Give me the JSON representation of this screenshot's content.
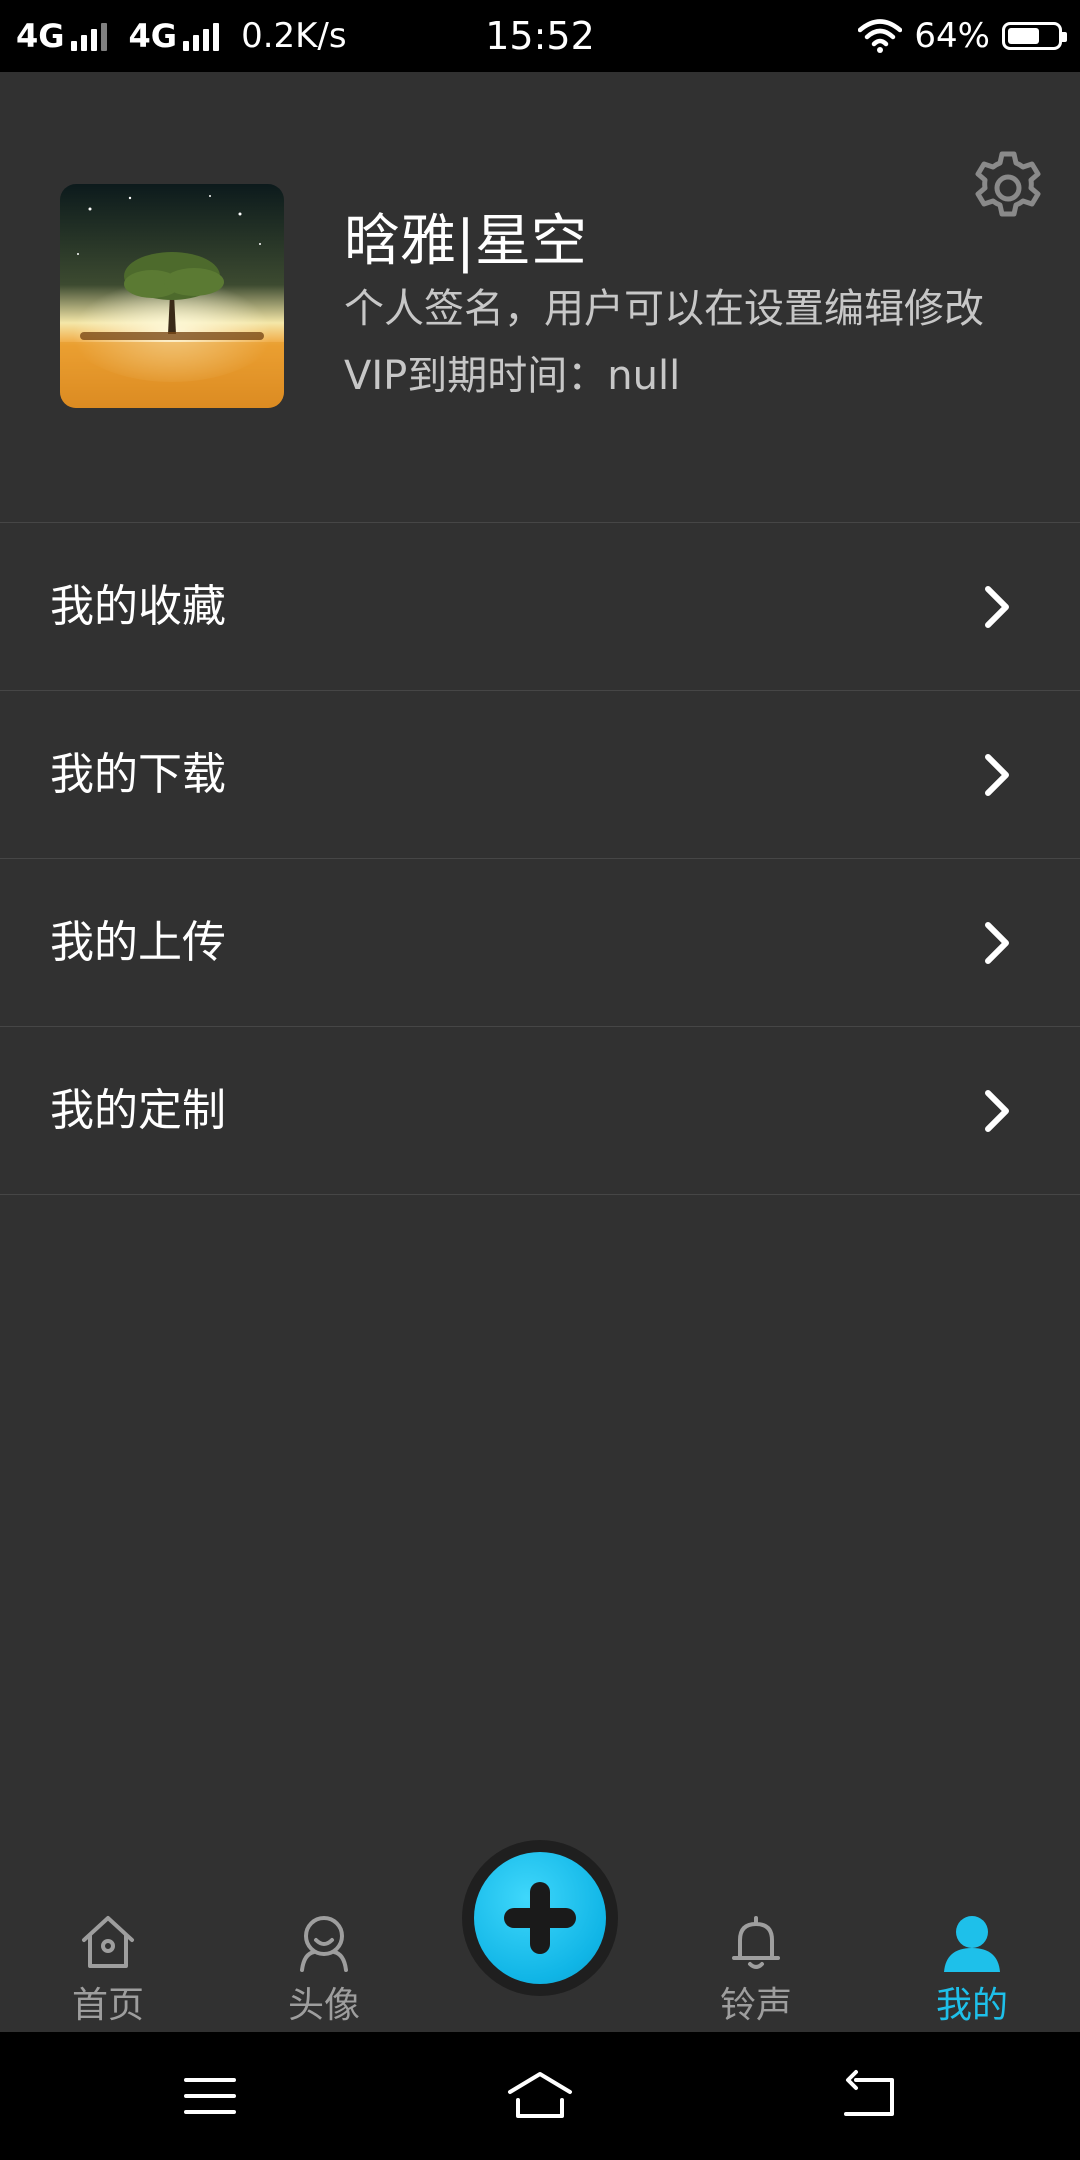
{
  "status_bar": {
    "network1": "4G",
    "network2": "4G",
    "speed": "0.2K/s",
    "time": "15:52",
    "battery": "64%",
    "battery_level": 0.64
  },
  "profile": {
    "username": "晗雅|星空",
    "signature": "个人签名，用户可以在设置编辑修改",
    "vip": "VIP到期时间：null",
    "settings_icon": "gear-icon"
  },
  "menu": {
    "items": [
      {
        "label": "我的收藏"
      },
      {
        "label": "我的下载"
      },
      {
        "label": "我的上传"
      },
      {
        "label": "我的定制"
      }
    ]
  },
  "tabbar": {
    "items": [
      {
        "label": "首页",
        "icon": "home-icon"
      },
      {
        "label": "头像",
        "icon": "avatar-icon"
      },
      {
        "label": "铃声",
        "icon": "bell-icon"
      },
      {
        "label": "我的",
        "icon": "user-icon"
      }
    ],
    "active_color": "#1ec0ea",
    "inactive_color": "#9e9e9e",
    "add_icon": "plus-icon"
  },
  "navbar": {
    "menu_icon": "menu-icon",
    "home_icon": "home-outline-icon",
    "back_icon": "back-icon"
  }
}
